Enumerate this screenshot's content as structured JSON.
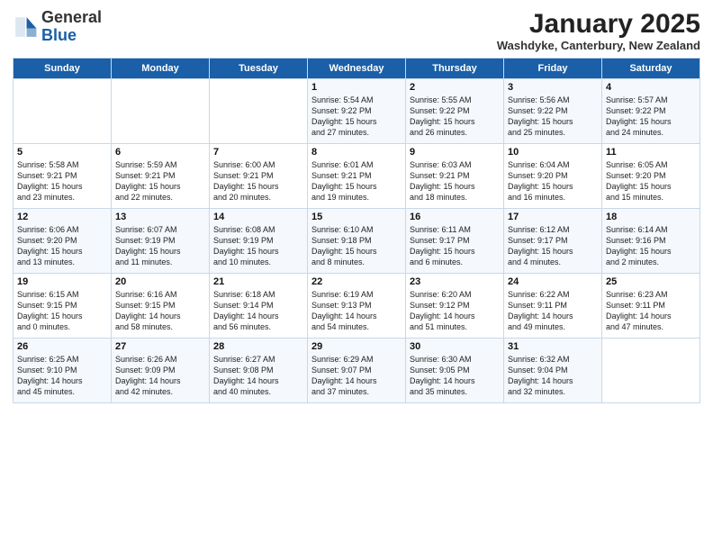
{
  "header": {
    "logo_general": "General",
    "logo_blue": "Blue",
    "month_title": "January 2025",
    "subtitle": "Washdyke, Canterbury, New Zealand"
  },
  "days_of_week": [
    "Sunday",
    "Monday",
    "Tuesday",
    "Wednesday",
    "Thursday",
    "Friday",
    "Saturday"
  ],
  "weeks": [
    [
      {
        "day": "",
        "info": ""
      },
      {
        "day": "",
        "info": ""
      },
      {
        "day": "",
        "info": ""
      },
      {
        "day": "1",
        "info": "Sunrise: 5:54 AM\nSunset: 9:22 PM\nDaylight: 15 hours\nand 27 minutes."
      },
      {
        "day": "2",
        "info": "Sunrise: 5:55 AM\nSunset: 9:22 PM\nDaylight: 15 hours\nand 26 minutes."
      },
      {
        "day": "3",
        "info": "Sunrise: 5:56 AM\nSunset: 9:22 PM\nDaylight: 15 hours\nand 25 minutes."
      },
      {
        "day": "4",
        "info": "Sunrise: 5:57 AM\nSunset: 9:22 PM\nDaylight: 15 hours\nand 24 minutes."
      }
    ],
    [
      {
        "day": "5",
        "info": "Sunrise: 5:58 AM\nSunset: 9:21 PM\nDaylight: 15 hours\nand 23 minutes."
      },
      {
        "day": "6",
        "info": "Sunrise: 5:59 AM\nSunset: 9:21 PM\nDaylight: 15 hours\nand 22 minutes."
      },
      {
        "day": "7",
        "info": "Sunrise: 6:00 AM\nSunset: 9:21 PM\nDaylight: 15 hours\nand 20 minutes."
      },
      {
        "day": "8",
        "info": "Sunrise: 6:01 AM\nSunset: 9:21 PM\nDaylight: 15 hours\nand 19 minutes."
      },
      {
        "day": "9",
        "info": "Sunrise: 6:03 AM\nSunset: 9:21 PM\nDaylight: 15 hours\nand 18 minutes."
      },
      {
        "day": "10",
        "info": "Sunrise: 6:04 AM\nSunset: 9:20 PM\nDaylight: 15 hours\nand 16 minutes."
      },
      {
        "day": "11",
        "info": "Sunrise: 6:05 AM\nSunset: 9:20 PM\nDaylight: 15 hours\nand 15 minutes."
      }
    ],
    [
      {
        "day": "12",
        "info": "Sunrise: 6:06 AM\nSunset: 9:20 PM\nDaylight: 15 hours\nand 13 minutes."
      },
      {
        "day": "13",
        "info": "Sunrise: 6:07 AM\nSunset: 9:19 PM\nDaylight: 15 hours\nand 11 minutes."
      },
      {
        "day": "14",
        "info": "Sunrise: 6:08 AM\nSunset: 9:19 PM\nDaylight: 15 hours\nand 10 minutes."
      },
      {
        "day": "15",
        "info": "Sunrise: 6:10 AM\nSunset: 9:18 PM\nDaylight: 15 hours\nand 8 minutes."
      },
      {
        "day": "16",
        "info": "Sunrise: 6:11 AM\nSunset: 9:17 PM\nDaylight: 15 hours\nand 6 minutes."
      },
      {
        "day": "17",
        "info": "Sunrise: 6:12 AM\nSunset: 9:17 PM\nDaylight: 15 hours\nand 4 minutes."
      },
      {
        "day": "18",
        "info": "Sunrise: 6:14 AM\nSunset: 9:16 PM\nDaylight: 15 hours\nand 2 minutes."
      }
    ],
    [
      {
        "day": "19",
        "info": "Sunrise: 6:15 AM\nSunset: 9:15 PM\nDaylight: 15 hours\nand 0 minutes."
      },
      {
        "day": "20",
        "info": "Sunrise: 6:16 AM\nSunset: 9:15 PM\nDaylight: 14 hours\nand 58 minutes."
      },
      {
        "day": "21",
        "info": "Sunrise: 6:18 AM\nSunset: 9:14 PM\nDaylight: 14 hours\nand 56 minutes."
      },
      {
        "day": "22",
        "info": "Sunrise: 6:19 AM\nSunset: 9:13 PM\nDaylight: 14 hours\nand 54 minutes."
      },
      {
        "day": "23",
        "info": "Sunrise: 6:20 AM\nSunset: 9:12 PM\nDaylight: 14 hours\nand 51 minutes."
      },
      {
        "day": "24",
        "info": "Sunrise: 6:22 AM\nSunset: 9:11 PM\nDaylight: 14 hours\nand 49 minutes."
      },
      {
        "day": "25",
        "info": "Sunrise: 6:23 AM\nSunset: 9:11 PM\nDaylight: 14 hours\nand 47 minutes."
      }
    ],
    [
      {
        "day": "26",
        "info": "Sunrise: 6:25 AM\nSunset: 9:10 PM\nDaylight: 14 hours\nand 45 minutes."
      },
      {
        "day": "27",
        "info": "Sunrise: 6:26 AM\nSunset: 9:09 PM\nDaylight: 14 hours\nand 42 minutes."
      },
      {
        "day": "28",
        "info": "Sunrise: 6:27 AM\nSunset: 9:08 PM\nDaylight: 14 hours\nand 40 minutes."
      },
      {
        "day": "29",
        "info": "Sunrise: 6:29 AM\nSunset: 9:07 PM\nDaylight: 14 hours\nand 37 minutes."
      },
      {
        "day": "30",
        "info": "Sunrise: 6:30 AM\nSunset: 9:05 PM\nDaylight: 14 hours\nand 35 minutes."
      },
      {
        "day": "31",
        "info": "Sunrise: 6:32 AM\nSunset: 9:04 PM\nDaylight: 14 hours\nand 32 minutes."
      },
      {
        "day": "",
        "info": ""
      }
    ]
  ]
}
